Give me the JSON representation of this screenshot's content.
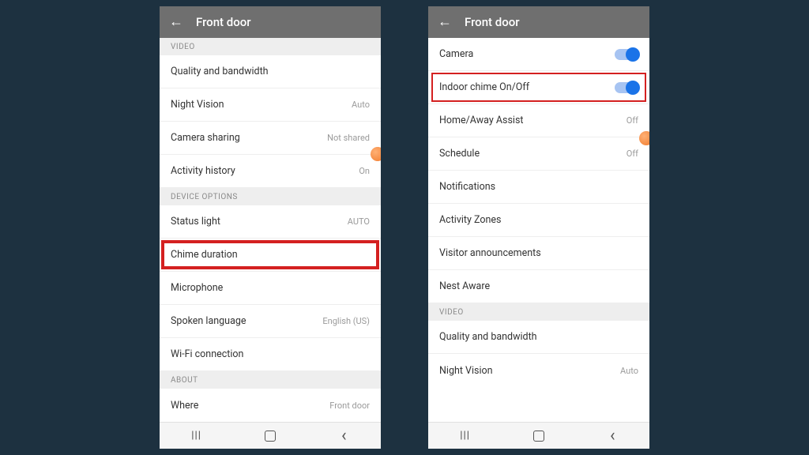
{
  "left": {
    "title": "Front door",
    "sections": {
      "video": "VIDEO",
      "device_options": "DEVICE OPTIONS",
      "about": "ABOUT"
    },
    "rows": {
      "quality": {
        "label": "Quality and bandwidth",
        "value": ""
      },
      "night_vision": {
        "label": "Night Vision",
        "value": "Auto"
      },
      "camera_sharing": {
        "label": "Camera sharing",
        "value": "Not shared"
      },
      "activity_history": {
        "label": "Activity history",
        "value": "On"
      },
      "status_light": {
        "label": "Status light",
        "value": "AUTO"
      },
      "chime_duration": {
        "label": "Chime duration",
        "value": ""
      },
      "microphone": {
        "label": "Microphone",
        "value": ""
      },
      "spoken_language": {
        "label": "Spoken language",
        "value": "English (US)"
      },
      "wifi": {
        "label": "Wi-Fi connection",
        "value": ""
      },
      "where": {
        "label": "Where",
        "value": "Front door"
      }
    }
  },
  "right": {
    "title": "Front door",
    "sections": {
      "video": "VIDEO"
    },
    "rows": {
      "camera": {
        "label": "Camera"
      },
      "indoor_chime": {
        "label": "Indoor chime On/Off"
      },
      "home_away": {
        "label": "Home/Away Assist",
        "value": "Off"
      },
      "schedule": {
        "label": "Schedule",
        "value": "Off"
      },
      "notifications": {
        "label": "Notifications",
        "value": ""
      },
      "activity_zones": {
        "label": "Activity Zones",
        "value": ""
      },
      "visitor": {
        "label": "Visitor announcements",
        "value": ""
      },
      "nest_aware": {
        "label": "Nest Aware",
        "value": ""
      },
      "quality": {
        "label": "Quality and bandwidth",
        "value": ""
      },
      "night_vision": {
        "label": "Night Vision",
        "value": "Auto"
      }
    }
  }
}
